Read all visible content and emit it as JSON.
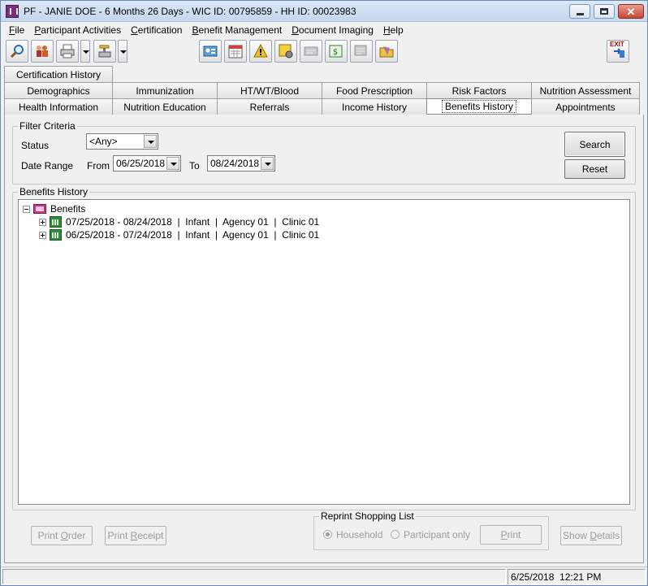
{
  "window": {
    "title": "PF - JANIE DOE - 6 Months 26 Days - WIC ID: 00795859 - HH ID: 00023983"
  },
  "menu": [
    {
      "u": "F",
      "rest": "ile"
    },
    {
      "u": "P",
      "rest": "articipant Activities"
    },
    {
      "u": "C",
      "rest": "ertification"
    },
    {
      "u": "B",
      "rest": "enefit Management"
    },
    {
      "u": "D",
      "rest": "ocument Imaging"
    },
    {
      "u": "H",
      "rest": "elp"
    }
  ],
  "toolbar": {
    "icons": [
      "search-icon",
      "family-icon",
      "printer-icon",
      "scale-icon",
      "id-card-icon",
      "calendar-icon",
      "warning-icon",
      "note-settings-icon",
      "card-icon",
      "voucher-icon",
      "list-icon",
      "folder-icon",
      "exit-icon"
    ],
    "exit_label": "EXIT"
  },
  "tabs": {
    "row1": [
      "Certification History"
    ],
    "row2": [
      "Demographics",
      "Immunization",
      "HT/WT/Blood",
      "Food Prescription",
      "Risk Factors",
      "Nutrition Assessment"
    ],
    "row3": [
      "Health Information",
      "Nutrition Education",
      "Referrals",
      "Income History",
      "Benefits History",
      "Appointments"
    ],
    "active": "Benefits History"
  },
  "filter": {
    "legend": "Filter Criteria",
    "status_label": "Status",
    "status_value": "<Any>",
    "date_range_label": "Date Range",
    "from_label": "From",
    "from_value": "06/25/2018",
    "to_label": "To",
    "to_value": "08/24/2018",
    "search_label": "Search",
    "reset_label": "Reset"
  },
  "history": {
    "legend": "Benefits History",
    "root_label": "Benefits",
    "items": [
      "07/25/2018 - 08/24/2018  |  Infant  |  Agency 01  |  Clinic 01",
      "06/25/2018 - 07/24/2018  |  Infant  |  Agency 01  |  Clinic 01"
    ]
  },
  "footer": {
    "print_order": {
      "pre": "Print ",
      "u": "O",
      "post": "rder"
    },
    "print_receipt": {
      "pre": "Print ",
      "u": "R",
      "post": "eceipt"
    },
    "reprint_legend": "Reprint Shopping List",
    "household_label": "Household",
    "participant_only_label": "Participant only",
    "print": {
      "pre": "",
      "u": "P",
      "post": "rint"
    },
    "show_details": {
      "pre": "Show ",
      "u": "D",
      "post": "etails"
    }
  },
  "status": {
    "datetime": "6/25/2018  12:21 PM"
  },
  "colors": {
    "titlebar": "#c4d7ee",
    "close_button": "#c44a36",
    "tree_root_icon": "#c23a7a",
    "tree_node_icon": "#2f8a3a"
  }
}
